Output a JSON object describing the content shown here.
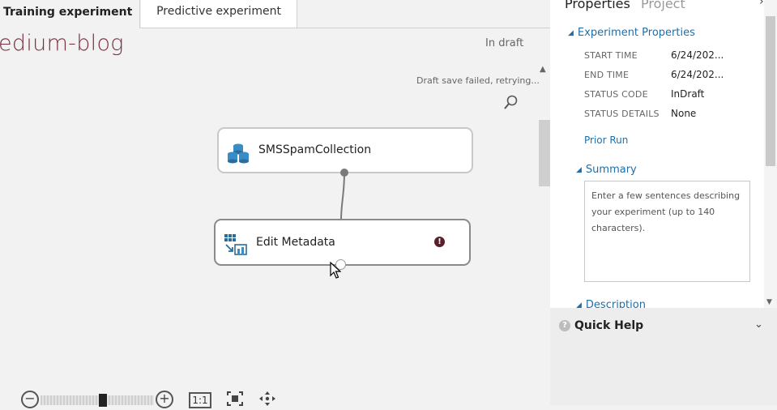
{
  "tabs": {
    "active": "Training experiment",
    "inactive": "Predictive experiment"
  },
  "experiment": {
    "title": "edium-blog",
    "state": "In draft",
    "save_status": "Draft save failed, retrying..."
  },
  "modules": {
    "dataset": {
      "label": "SMSSpamCollection",
      "icon": "dataset-icon"
    },
    "edit_metadata": {
      "label": "Edit Metadata",
      "icon": "edit-metadata-icon",
      "warning": "!"
    }
  },
  "toolbar": {
    "zoom_out": "−",
    "zoom_in": "+",
    "actual_size": "1:1",
    "zoom_level": 0.55
  },
  "panel": {
    "tabs": {
      "properties": "Properties",
      "project": "Project"
    },
    "experiment_properties": {
      "heading": "Experiment Properties",
      "rows": [
        {
          "key": "START TIME",
          "value": "6/24/202..."
        },
        {
          "key": "END TIME",
          "value": "6/24/202..."
        },
        {
          "key": "STATUS CODE",
          "value": "InDraft"
        },
        {
          "key": "STATUS DETAILS",
          "value": "None"
        }
      ],
      "prior_run": "Prior Run"
    },
    "summary": {
      "heading": "Summary",
      "placeholder": "Enter a few sentences describing your experiment (up to 140 characters)."
    },
    "description": {
      "heading": "Description"
    }
  },
  "quick_help": {
    "label": "Quick Help",
    "icon": "help-icon"
  },
  "colors": {
    "accent": "#1e6fa8",
    "title": "#7a2f3f",
    "warning": "#5a1f2b"
  }
}
